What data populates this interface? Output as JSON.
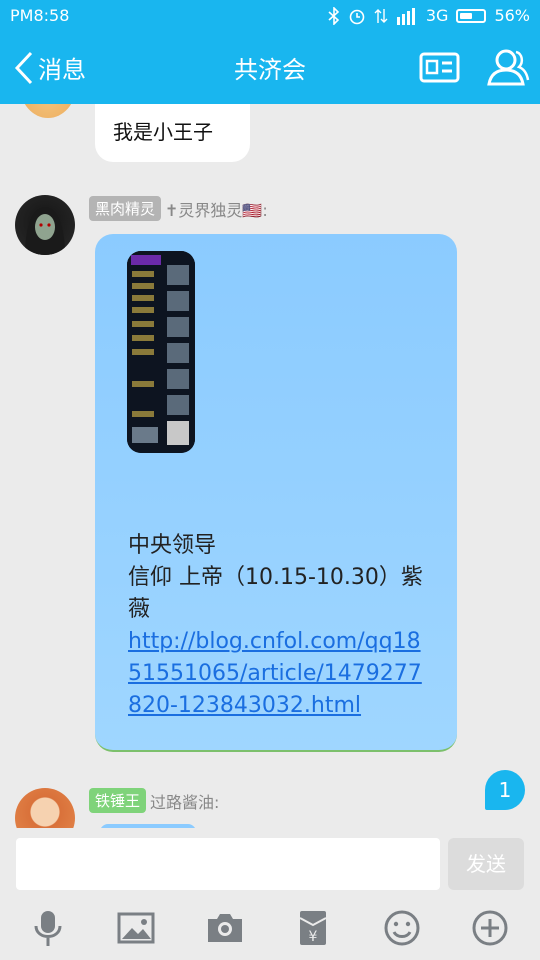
{
  "status": {
    "time": "PM8:58",
    "network": "3G",
    "battery": "56%",
    "battery_level": 0.56
  },
  "header": {
    "back_label": "消息",
    "title": "共济会"
  },
  "messages": {
    "prev_text": "我是小王子",
    "post": {
      "badge": "黑肉精灵",
      "sender_name": "✝灵界独灵🇺🇸:",
      "line1": "中央领导",
      "line2": "信仰 上帝（10.15-10.30）紫薇",
      "link": "http://blog.cnfol.com/qq1851551065/article/1479277820-123843032.html"
    },
    "next": {
      "badge": "铁锤王",
      "sender_name": "过路酱油:"
    }
  },
  "unread_count": "1",
  "input": {
    "placeholder": "",
    "send_label": "发送"
  },
  "colors": {
    "accent": "#19b6ef",
    "bubble": "#8bcbff",
    "badge_gray": "#b4b4b4",
    "badge_green": "#7fd37a"
  }
}
